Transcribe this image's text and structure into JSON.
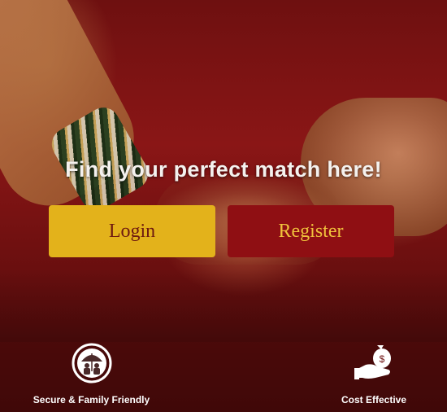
{
  "headline": "Find your perfect match here!",
  "buttons": {
    "login": "Login",
    "register": "Register"
  },
  "features": [
    {
      "label": "Secure & Family Friendly",
      "icon": "family-umbrella-icon"
    },
    {
      "label": "Cost Effective",
      "icon": "money-hand-icon"
    }
  ],
  "colors": {
    "login_bg": "#e3b21b",
    "login_text": "#6e1a10",
    "register_bg": "#8f0f13",
    "register_text": "#f0c23c",
    "background": "#8a1616"
  }
}
